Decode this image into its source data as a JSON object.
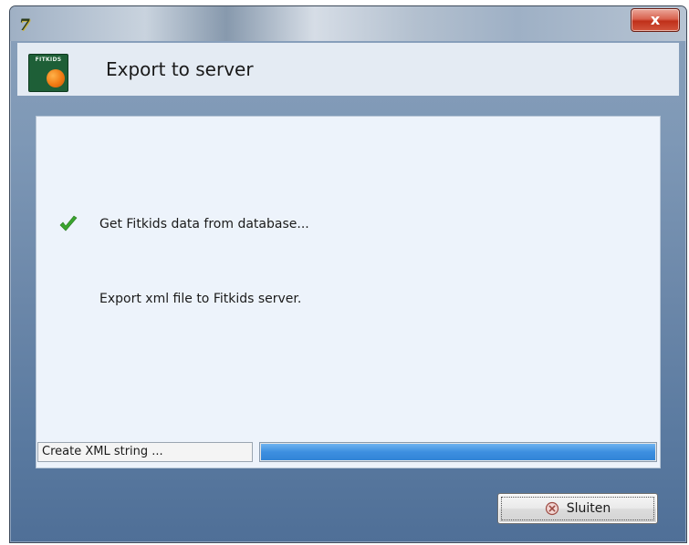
{
  "window": {
    "close_glyph": "x",
    "app_icon_glyph": "7"
  },
  "header": {
    "title": "Export to server",
    "logo_text": "FITKIDS"
  },
  "steps": [
    {
      "label": "Get Fitkids data from database...",
      "done": true,
      "icon": "checkmark-icon"
    },
    {
      "label": "Export xml file to Fitkids server.",
      "done": false
    }
  ],
  "status": {
    "text": "Create XML string ...",
    "progress": 1.0
  },
  "buttons": {
    "sluiten_label": "Sluiten",
    "sluiten_icon": "cancel-circle-icon"
  },
  "colors": {
    "progress": "#3d8fe0",
    "check": "#3aa52e"
  }
}
